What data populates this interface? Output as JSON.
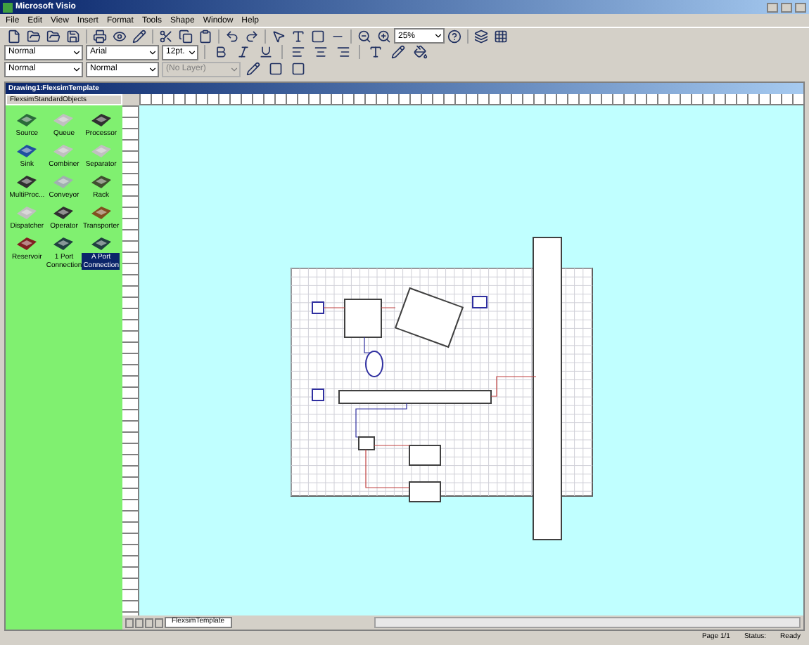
{
  "window": {
    "title": "Microsoft Visio"
  },
  "menu": [
    "File",
    "Edit",
    "View",
    "Insert",
    "Format",
    "Tools",
    "Shape",
    "Window",
    "Help"
  ],
  "toolbar": {
    "zoom": "25%",
    "style": "Normal",
    "font": "Arial",
    "size": "12pt.",
    "line_style": "Normal",
    "fill_style": "Normal",
    "layer": "(No Layer)"
  },
  "drawing": {
    "title": "Drawing1:FlexsimTemplate"
  },
  "stencil": {
    "title": "FlexsimStandardObjects",
    "items": [
      {
        "label": "Source",
        "selected": false
      },
      {
        "label": "Queue",
        "selected": false
      },
      {
        "label": "Processor",
        "selected": false
      },
      {
        "label": "Sink",
        "selected": false
      },
      {
        "label": "Combiner",
        "selected": false
      },
      {
        "label": "Separator",
        "selected": false
      },
      {
        "label": "MultiProc...",
        "selected": false
      },
      {
        "label": "Conveyor",
        "selected": false
      },
      {
        "label": "Rack",
        "selected": false
      },
      {
        "label": "Dispatcher",
        "selected": false
      },
      {
        "label": "Operator",
        "selected": false
      },
      {
        "label": "Transporter",
        "selected": false
      },
      {
        "label": "Reservoir",
        "selected": false
      },
      {
        "label": "1 Port Connection",
        "selected": false
      },
      {
        "label": "A Port Connection",
        "selected": true
      }
    ]
  },
  "sheet_tabs": [
    {
      "label": "FlexsimTemplate",
      "selected": true
    }
  ],
  "status_bar": {
    "page": "Page 1/1",
    "status_label": "Status:",
    "status": "Ready"
  }
}
